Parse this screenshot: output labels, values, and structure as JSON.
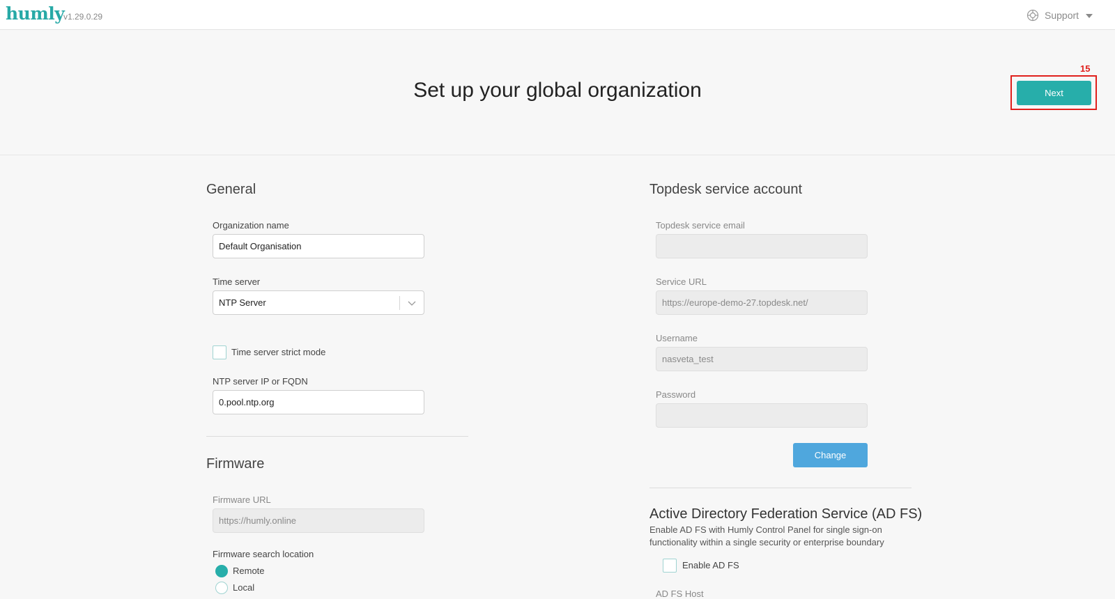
{
  "header": {
    "logo_text": "humly",
    "version": "v1.29.0.29",
    "support_label": "Support"
  },
  "hero": {
    "title": "Set up your global organization",
    "next_label": "Next",
    "annotation_number": "15"
  },
  "general": {
    "title": "General",
    "org_name_label": "Organization name",
    "org_name_value": "Default Organisation",
    "time_server_label": "Time server",
    "time_server_value": "NTP Server",
    "strict_mode_label": "Time server strict mode",
    "ntp_label": "NTP server IP or FQDN",
    "ntp_value": "0.pool.ntp.org"
  },
  "firmware": {
    "title": "Firmware",
    "url_label": "Firmware URL",
    "url_value": "https://humly.online",
    "search_location_label": "Firmware search location",
    "options": [
      "Remote",
      "Local"
    ],
    "selected": "Remote"
  },
  "topdesk": {
    "title": "Topdesk service account",
    "email_label": "Topdesk service email",
    "email_value": "",
    "service_url_label": "Service URL",
    "service_url_value": "https://europe-demo-27.topdesk.net/",
    "username_label": "Username",
    "username_value": "nasveta_test",
    "password_label": "Password",
    "password_value": "",
    "change_label": "Change"
  },
  "adfs": {
    "title": "Active Directory Federation Service (AD FS)",
    "description": "Enable AD FS with Humly Control Panel for single sign-on functionality within a single security or enterprise boundary",
    "enable_label": "Enable AD FS",
    "host_label": "AD FS Host"
  },
  "colors": {
    "accent": "#27aeaa",
    "change_button": "#4fa7dd",
    "highlight": "#e0201c"
  }
}
